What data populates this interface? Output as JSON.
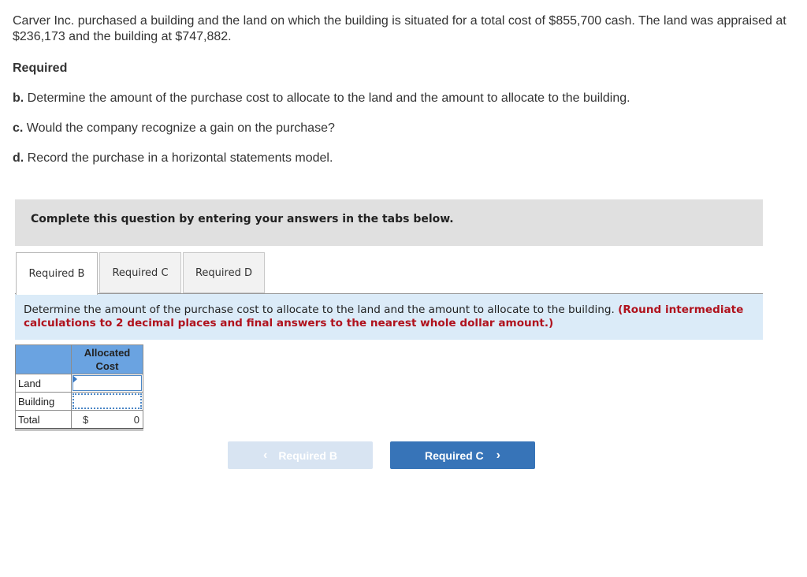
{
  "problem": {
    "text": "Carver Inc. purchased a building and the land on which the building is situated for a total cost of $855,700 cash. The land was appraised at $236,173 and the building at $747,882."
  },
  "required_heading": "Required",
  "requirements": [
    {
      "letter": "b.",
      "text": " Determine the amount of the purchase cost to allocate to the land and the amount to allocate to the building."
    },
    {
      "letter": "c.",
      "text": " Would the company recognize a gain on the purchase?"
    },
    {
      "letter": "d.",
      "text": " Record the purchase in a horizontal statements model."
    }
  ],
  "banner": "Complete this question by entering your answers in the tabs below.",
  "tabs": [
    {
      "label": "Required B",
      "active": true
    },
    {
      "label": "Required C",
      "active": false
    },
    {
      "label": "Required D",
      "active": false
    }
  ],
  "instruction": {
    "text": "Determine the amount of the purchase cost to allocate to the land and the amount to allocate to the building. ",
    "note": "(Round intermediate calculations to 2 decimal places and final answers to the nearest whole dollar amount.)"
  },
  "table": {
    "header": "Allocated Cost",
    "rows": [
      {
        "label": "Land",
        "value": ""
      },
      {
        "label": "Building",
        "value": ""
      }
    ],
    "total": {
      "label": "Total",
      "currency": "$",
      "value": "0"
    }
  },
  "nav": {
    "prev_label": "Required B",
    "next_label": "Required C",
    "prev_icon": "‹",
    "next_icon": "›"
  }
}
